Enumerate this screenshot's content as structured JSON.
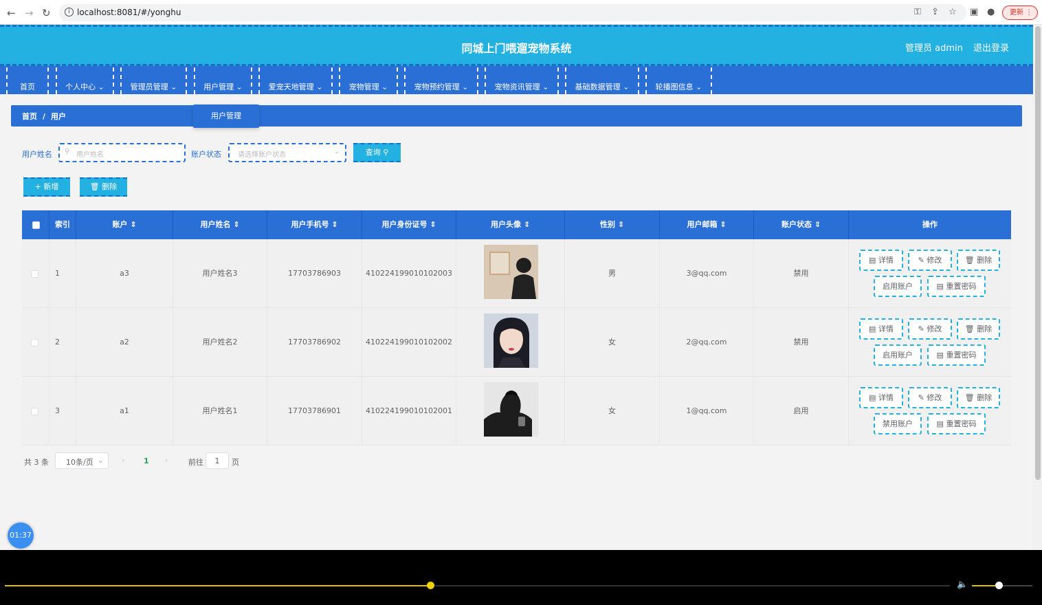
{
  "browser": {
    "url": "localhost:8081/#/yonghu",
    "update_label": "更新"
  },
  "header": {
    "title": "同城上门喂遛宠物系统",
    "admin": "管理员 admin",
    "logout": "退出登录"
  },
  "menu": {
    "items": [
      {
        "label": "首页",
        "arrow": false
      },
      {
        "label": "个人中心",
        "arrow": true
      },
      {
        "label": "管理员管理",
        "arrow": true
      },
      {
        "label": "用户管理",
        "arrow": true
      },
      {
        "label": "爱宠天地管理",
        "arrow": true
      },
      {
        "label": "宠物管理",
        "arrow": true
      },
      {
        "label": "宠物预约管理",
        "arrow": true
      },
      {
        "label": "宠物资讯管理",
        "arrow": true
      },
      {
        "label": "基础数据管理",
        "arrow": true
      },
      {
        "label": "轮播图信息",
        "arrow": true
      }
    ],
    "dropdown_item": "用户管理"
  },
  "breadcrumb": {
    "home": "首页",
    "separator": "/",
    "current": "用户"
  },
  "search": {
    "name_label": "用户姓名",
    "name_placeholder": "用户姓名",
    "status_label": "账户状态",
    "status_placeholder": "请选择账户状态",
    "query_label": "查询"
  },
  "actions": {
    "add_label": "+ 新增",
    "delete_label": "删除"
  },
  "table": {
    "headers": [
      "索引",
      "账户",
      "用户姓名",
      "用户手机号",
      "用户身份证号",
      "用户头像",
      "性别",
      "用户邮箱",
      "账户状态",
      "操作"
    ],
    "rows": [
      {
        "index": "1",
        "account": "a3",
        "name": "用户姓名3",
        "phone": "17703786903",
        "idcard": "410224199010102003",
        "gender": "男",
        "email": "3@qq.com",
        "status": "禁用",
        "toggle_label": "启用账户"
      },
      {
        "index": "2",
        "account": "a2",
        "name": "用户姓名2",
        "phone": "17703786902",
        "idcard": "410224199010102002",
        "gender": "女",
        "email": "2@qq.com",
        "status": "禁用",
        "toggle_label": "启用账户"
      },
      {
        "index": "3",
        "account": "a1",
        "name": "用户姓名1",
        "phone": "17703786901",
        "idcard": "410224199010102001",
        "gender": "女",
        "email": "1@qq.com",
        "status": "启用",
        "toggle_label": "禁用账户"
      }
    ],
    "op_labels": {
      "detail": "详情",
      "edit": "修改",
      "delete": "删除",
      "reset": "重置密码"
    }
  },
  "pager": {
    "total": "共 3 条",
    "page_size": "10条/页",
    "current": "1",
    "goto_label": "前往",
    "goto_value": "1",
    "page_unit": "页"
  },
  "timer": "01:37",
  "player": {
    "progress": 0.45,
    "volume": 0.45
  }
}
